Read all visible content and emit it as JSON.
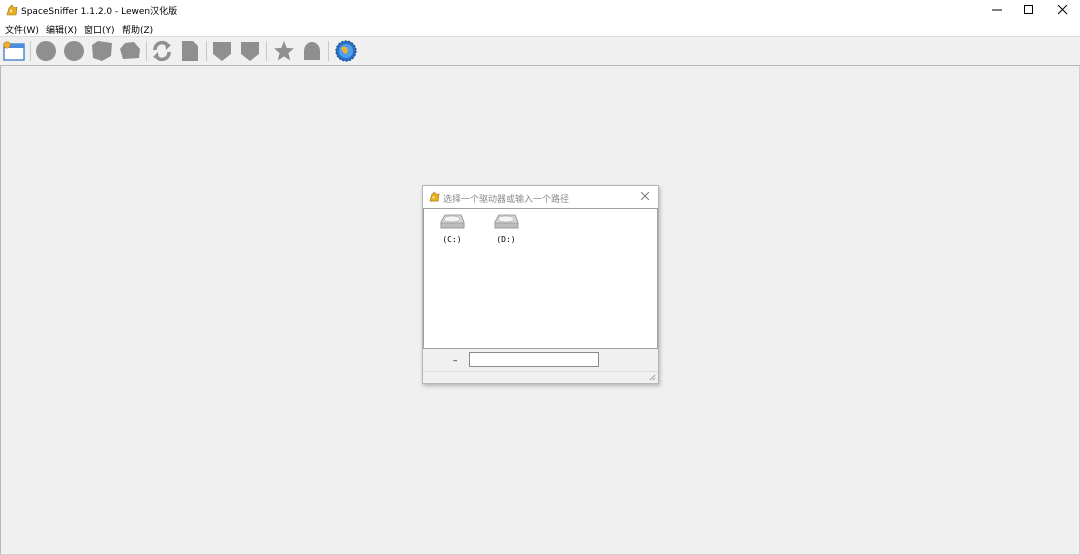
{
  "window": {
    "title": "SpaceSniffer 1.1.2.0 - Lewen汉化版"
  },
  "menu": [
    {
      "label": "文件(W)"
    },
    {
      "label": "编辑(X)"
    },
    {
      "label": "窗口(Y)"
    },
    {
      "label": "帮助(Z)"
    }
  ],
  "toolbar": {
    "icons": [
      "new-window-icon",
      "circle-icon",
      "circle-icon",
      "shape-icon",
      "shape-icon",
      "refresh-icon",
      "document-icon",
      "shield-icon",
      "shield-icon",
      "star-icon",
      "bell-icon",
      "globe-icon"
    ],
    "colors": {
      "disabled": "#8f8f8f",
      "accent": "#2a6fc4"
    }
  },
  "dialog": {
    "title": "选择一个驱动器或输入一个路径",
    "drives": [
      {
        "label": "(C:)"
      },
      {
        "label": "(D:)"
      }
    ],
    "dash": "–",
    "path_value": ""
  }
}
